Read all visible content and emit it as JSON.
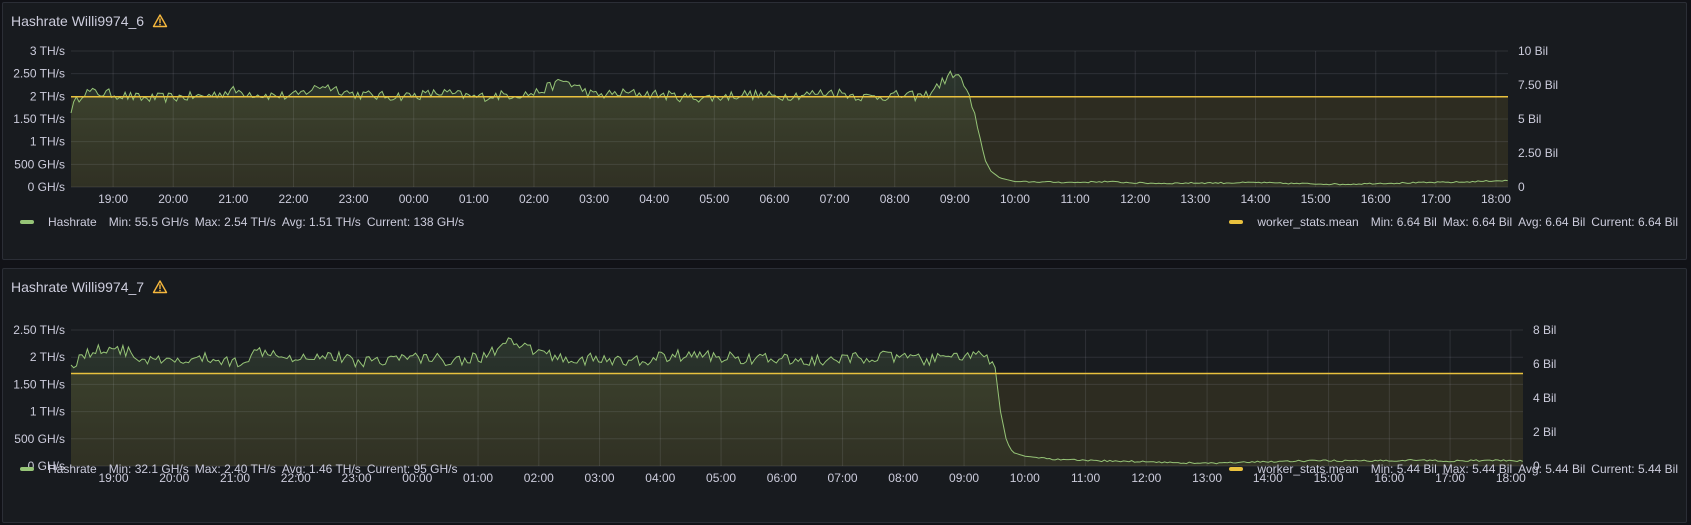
{
  "colors": {
    "hashrate": "#96c477",
    "hashrate_fill": "rgba(150,196,119,0.16)",
    "hashrate_fill_end": "rgba(150,196,119,0.03)",
    "worker": "#e9c13e",
    "worker_fill": "rgba(233,193,62,0.10)",
    "grid": "rgba(204,204,220,0.12)",
    "warning": "#f5b73d"
  },
  "panels": [
    {
      "title": "Hashrate Willi9974_6",
      "warning_icon": "warning-triangle-icon",
      "legend_left": {
        "name": "Hashrate",
        "min": "Min: 55.5 GH/s",
        "max": "Max: 2.54 TH/s",
        "avg": "Avg: 1.51 TH/s",
        "current": "Current: 138 GH/s"
      },
      "legend_right": {
        "name": "worker_stats.mean",
        "min": "Min: 6.64 Bil",
        "max": "Max: 6.64 Bil",
        "avg": "Avg: 6.64 Bil",
        "current": "Current: 6.64 Bil"
      }
    },
    {
      "title": "Hashrate Willi9974_7",
      "warning_icon": "warning-triangle-icon",
      "legend_left": {
        "name": "Hashrate",
        "min": "Min: 32.1 GH/s",
        "max": "Max: 2.40 TH/s",
        "avg": "Avg: 1.46 TH/s",
        "current": "Current: 95 GH/s"
      },
      "legend_right": {
        "name": "worker_stats.mean",
        "min": "Min: 5.44 Bil",
        "max": "Max: 5.44 Bil",
        "avg": "Avg: 5.44 Bil",
        "current": "Current: 5.44 Bil"
      }
    }
  ],
  "chart_data": [
    {
      "type": "area",
      "x_unit": "hours",
      "xlim": [
        18.3,
        18.2
      ],
      "x_ticks": [
        "19:00",
        "20:00",
        "21:00",
        "22:00",
        "23:00",
        "00:00",
        "01:00",
        "02:00",
        "03:00",
        "04:00",
        "05:00",
        "06:00",
        "07:00",
        "08:00",
        "09:00",
        "10:00",
        "11:00",
        "12:00",
        "13:00",
        "14:00",
        "15:00",
        "16:00",
        "17:00",
        "18:00"
      ],
      "y_left": {
        "unit": "TH/s",
        "ylim": [
          0,
          3
        ],
        "ticks": [
          {
            "value": 0,
            "label": "0 GH/s"
          },
          {
            "value": 0.5,
            "label": "500 GH/s"
          },
          {
            "value": 1,
            "label": "1 TH/s"
          },
          {
            "value": 1.5,
            "label": "1.50 TH/s"
          },
          {
            "value": 2,
            "label": "2 TH/s"
          },
          {
            "value": 2.5,
            "label": "2.50 TH/s"
          },
          {
            "value": 3,
            "label": "3 TH/s"
          }
        ]
      },
      "y_right": {
        "unit": "Bil",
        "ylim": [
          0,
          10
        ],
        "ticks": [
          {
            "value": 0,
            "label": "0"
          },
          {
            "value": 2.5,
            "label": "2.50 Bil"
          },
          {
            "value": 5,
            "label": "5 Bil"
          },
          {
            "value": 7.5,
            "label": "7.50 Bil"
          },
          {
            "value": 10,
            "label": "10 Bil"
          }
        ]
      },
      "grid": true,
      "legend_placement": "bottom",
      "series": [
        {
          "name": "Hashrate",
          "axis": "left",
          "x": [
            18.3,
            18.5,
            19.0,
            19.5,
            20.0,
            20.5,
            21.0,
            21.5,
            22.0,
            22.5,
            23.0,
            23.5,
            24.0,
            24.5,
            25.0,
            25.5,
            26.0,
            26.5,
            27.0,
            27.5,
            28.0,
            28.5,
            29.0,
            29.5,
            30.0,
            30.5,
            31.0,
            31.5,
            32.0,
            32.5,
            33.0,
            33.2,
            33.4,
            33.5,
            33.6,
            33.75,
            34.0,
            34.5,
            35.0,
            35.5,
            36.0,
            36.5,
            37.0,
            37.5,
            38.0,
            38.5,
            39.0,
            39.5,
            40.0,
            40.5,
            41.0,
            41.5,
            42.0,
            42.2
          ],
          "values": [
            1.72,
            2.1,
            2.05,
            1.95,
            1.98,
            2.0,
            2.12,
            2.03,
            2.0,
            2.25,
            2.05,
            2.0,
            2.02,
            2.08,
            1.98,
            2.03,
            2.06,
            2.35,
            2.02,
            2.07,
            2.05,
            1.98,
            1.97,
            2.05,
            2.0,
            2.04,
            2.1,
            1.98,
            2.02,
            2.0,
            2.54,
            2.15,
            1.2,
            0.6,
            0.35,
            0.2,
            0.12,
            0.11,
            0.1,
            0.12,
            0.09,
            0.08,
            0.09,
            0.09,
            0.1,
            0.08,
            0.07,
            0.06,
            0.08,
            0.09,
            0.1,
            0.11,
            0.14,
            0.138
          ]
        },
        {
          "name": "worker_stats.mean",
          "axis": "right",
          "x": [
            18.3,
            42.2
          ],
          "values": [
            6.64,
            6.64
          ]
        }
      ]
    },
    {
      "type": "area",
      "x_unit": "hours",
      "xlim": [
        18.3,
        18.2
      ],
      "x_ticks": [
        "19:00",
        "20:00",
        "21:00",
        "22:00",
        "23:00",
        "00:00",
        "01:00",
        "02:00",
        "03:00",
        "04:00",
        "05:00",
        "06:00",
        "07:00",
        "08:00",
        "09:00",
        "10:00",
        "11:00",
        "12:00",
        "13:00",
        "14:00",
        "15:00",
        "16:00",
        "17:00",
        "18:00"
      ],
      "y_left": {
        "unit": "TH/s",
        "ylim": [
          0,
          2.5
        ],
        "ticks": [
          {
            "value": 0,
            "label": "0 GH/s"
          },
          {
            "value": 0.5,
            "label": "500 GH/s"
          },
          {
            "value": 1,
            "label": "1 TH/s"
          },
          {
            "value": 1.5,
            "label": "1.50 TH/s"
          },
          {
            "value": 2,
            "label": "2 TH/s"
          },
          {
            "value": 2.5,
            "label": "2.50 TH/s"
          }
        ]
      },
      "y_right": {
        "unit": "Bil",
        "ylim": [
          0,
          8
        ],
        "ticks": [
          {
            "value": 0,
            "label": "0"
          },
          {
            "value": 2,
            "label": "2 Bil"
          },
          {
            "value": 4,
            "label": "4 Bil"
          },
          {
            "value": 6,
            "label": "6 Bil"
          },
          {
            "value": 8,
            "label": "8 Bil"
          }
        ]
      },
      "grid": true,
      "legend_placement": "bottom",
      "series": [
        {
          "name": "Hashrate",
          "axis": "left",
          "x": [
            18.3,
            18.5,
            19.0,
            19.5,
            20.0,
            20.5,
            21.0,
            21.5,
            22.0,
            22.5,
            23.0,
            23.5,
            24.0,
            24.5,
            25.0,
            25.5,
            26.0,
            26.5,
            27.0,
            27.5,
            28.0,
            28.5,
            29.0,
            29.5,
            30.0,
            30.5,
            31.0,
            31.5,
            32.0,
            32.5,
            33.0,
            33.3,
            33.5,
            33.6,
            33.7,
            33.8,
            34.0,
            34.5,
            35.0,
            35.5,
            36.0,
            36.5,
            37.0,
            37.5,
            38.0,
            38.5,
            39.0,
            39.5,
            40.0,
            40.5,
            41.0,
            41.5,
            42.0,
            42.2
          ],
          "values": [
            1.85,
            2.05,
            2.2,
            1.95,
            1.9,
            1.98,
            1.9,
            2.15,
            2.0,
            2.05,
            1.92,
            1.97,
            2.0,
            1.95,
            1.98,
            2.25,
            2.1,
            1.95,
            1.97,
            1.9,
            2.0,
            2.05,
            2.0,
            1.98,
            1.95,
            1.93,
            1.95,
            2.02,
            1.98,
            1.95,
            2.05,
            2.0,
            1.9,
            1.0,
            0.45,
            0.25,
            0.18,
            0.12,
            0.1,
            0.09,
            0.08,
            0.06,
            0.05,
            0.06,
            0.08,
            0.09,
            0.1,
            0.09,
            0.1,
            0.11,
            0.09,
            0.1,
            0.1,
            0.095
          ]
        },
        {
          "name": "worker_stats.mean",
          "axis": "right",
          "x": [
            18.3,
            42.2
          ],
          "values": [
            5.44,
            5.44
          ]
        }
      ]
    }
  ]
}
